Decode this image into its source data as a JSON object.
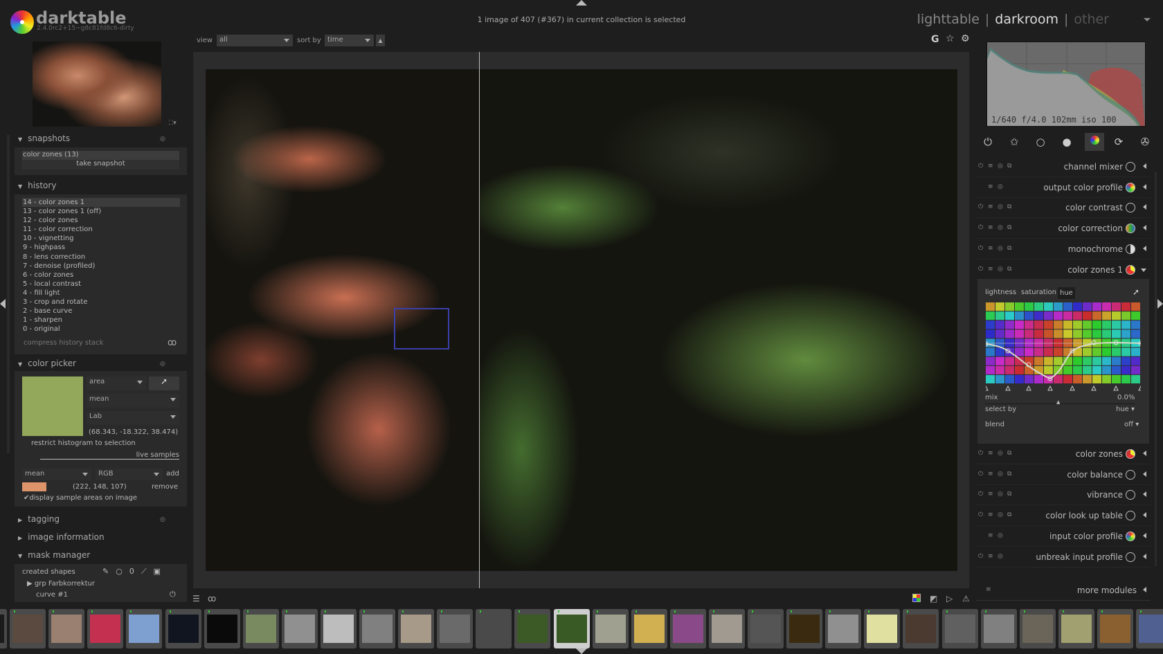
{
  "app": {
    "name": "darktable",
    "version": "2.4.0rc2+15~g8c81fd8c6-dirty"
  },
  "status": "1 image of 407 (#367) in current collection is selected",
  "views": {
    "items": [
      "lighttable",
      "darkroom",
      "other"
    ],
    "active": "darkroom"
  },
  "toolbar": {
    "view_label": "view",
    "view_value": "all",
    "sort_label": "sort by",
    "sort_value": "time"
  },
  "top_icons": [
    "G",
    "☆",
    "⚙"
  ],
  "left": {
    "snapshots": {
      "title": "snapshots",
      "items": [
        "color zones (13)"
      ],
      "take": "take snapshot"
    },
    "history": {
      "title": "history",
      "items": [
        "14 - color zones 1",
        "13 - color zones 1 (off)",
        "12 - color zones",
        "11 - color correction",
        "10 - vignetting",
        "9 - highpass",
        "8 - lens correction",
        "7 - denoise (profiled)",
        "6 - color zones",
        "5 - local contrast",
        "4 - fill light",
        "3 - crop and rotate",
        "2 - base curve",
        "1 - sharpen",
        "0 - original"
      ],
      "selected": 0,
      "compress": "compress history stack"
    },
    "color_picker": {
      "title": "color picker",
      "mode": "area",
      "stat": "mean",
      "space": "Lab",
      "swatch": "#93a85a",
      "values": "(68.343, -18.322, 38.474)",
      "restrict": "restrict histogram to selection",
      "live": "live samples",
      "live_stat": "mean",
      "live_space": "RGB",
      "add": "add",
      "sample_swatch": "#de946b",
      "sample_values": "(222, 148, 107)",
      "remove": "remove",
      "display": "display sample areas on image"
    },
    "tagging": "tagging",
    "image_information": "image information",
    "mask_manager": {
      "title": "mask manager",
      "created": "created shapes",
      "group": "grp Farbkorrektur",
      "curve": "curve #1"
    }
  },
  "right": {
    "exif": "1/640 f/4.0 102mm iso 100",
    "modules": [
      {
        "name": "channel mixer",
        "icon": "channel-mixer"
      },
      {
        "name": "output color profile",
        "icon": "color-profile"
      },
      {
        "name": "color contrast",
        "icon": "circle"
      },
      {
        "name": "color correction",
        "icon": "color-wheel"
      },
      {
        "name": "monochrome",
        "icon": "half-circle"
      },
      {
        "name": "color zones 1",
        "icon": "color-zones",
        "expanded": true
      }
    ],
    "modules_after": [
      {
        "name": "color zones",
        "icon": "color-zones"
      },
      {
        "name": "color balance",
        "icon": "circle"
      },
      {
        "name": "vibrance",
        "icon": "circle"
      },
      {
        "name": "color look up table",
        "icon": "circle"
      },
      {
        "name": "input color profile",
        "icon": "color-profile"
      },
      {
        "name": "unbreak input profile",
        "icon": "unbreak"
      }
    ],
    "color_zones": {
      "tabs": [
        "lightness",
        "saturation",
        "hue"
      ],
      "active_tab": "hue",
      "mix_label": "mix",
      "mix_value": "0.0%",
      "select_by_label": "select by",
      "select_by_value": "hue",
      "blend_label": "blend",
      "blend_value": "off"
    },
    "more_modules": "more modules"
  },
  "filmstrip": [
    "#1a1a1a",
    "#5a4a40",
    "#9a8070",
    "#c43050",
    "#7ea0d0",
    "#101520",
    "#0a0a0a",
    "#7a8a60",
    "#909090",
    "#bdbdbd",
    "#808080",
    "#a89a88",
    "#6a6a6a",
    "#4a4a4a",
    "#3c5a25",
    "#3a5a25",
    "#a0a090",
    "#d0b050",
    "#8a4a8a",
    "#a09a90",
    "#555555",
    "#3a2a10",
    "#909090",
    "#e0e0a0",
    "#4a3a30",
    "#606060",
    "#808080",
    "#6a6558",
    "#a0a070",
    "#8a6030",
    "#506090"
  ]
}
